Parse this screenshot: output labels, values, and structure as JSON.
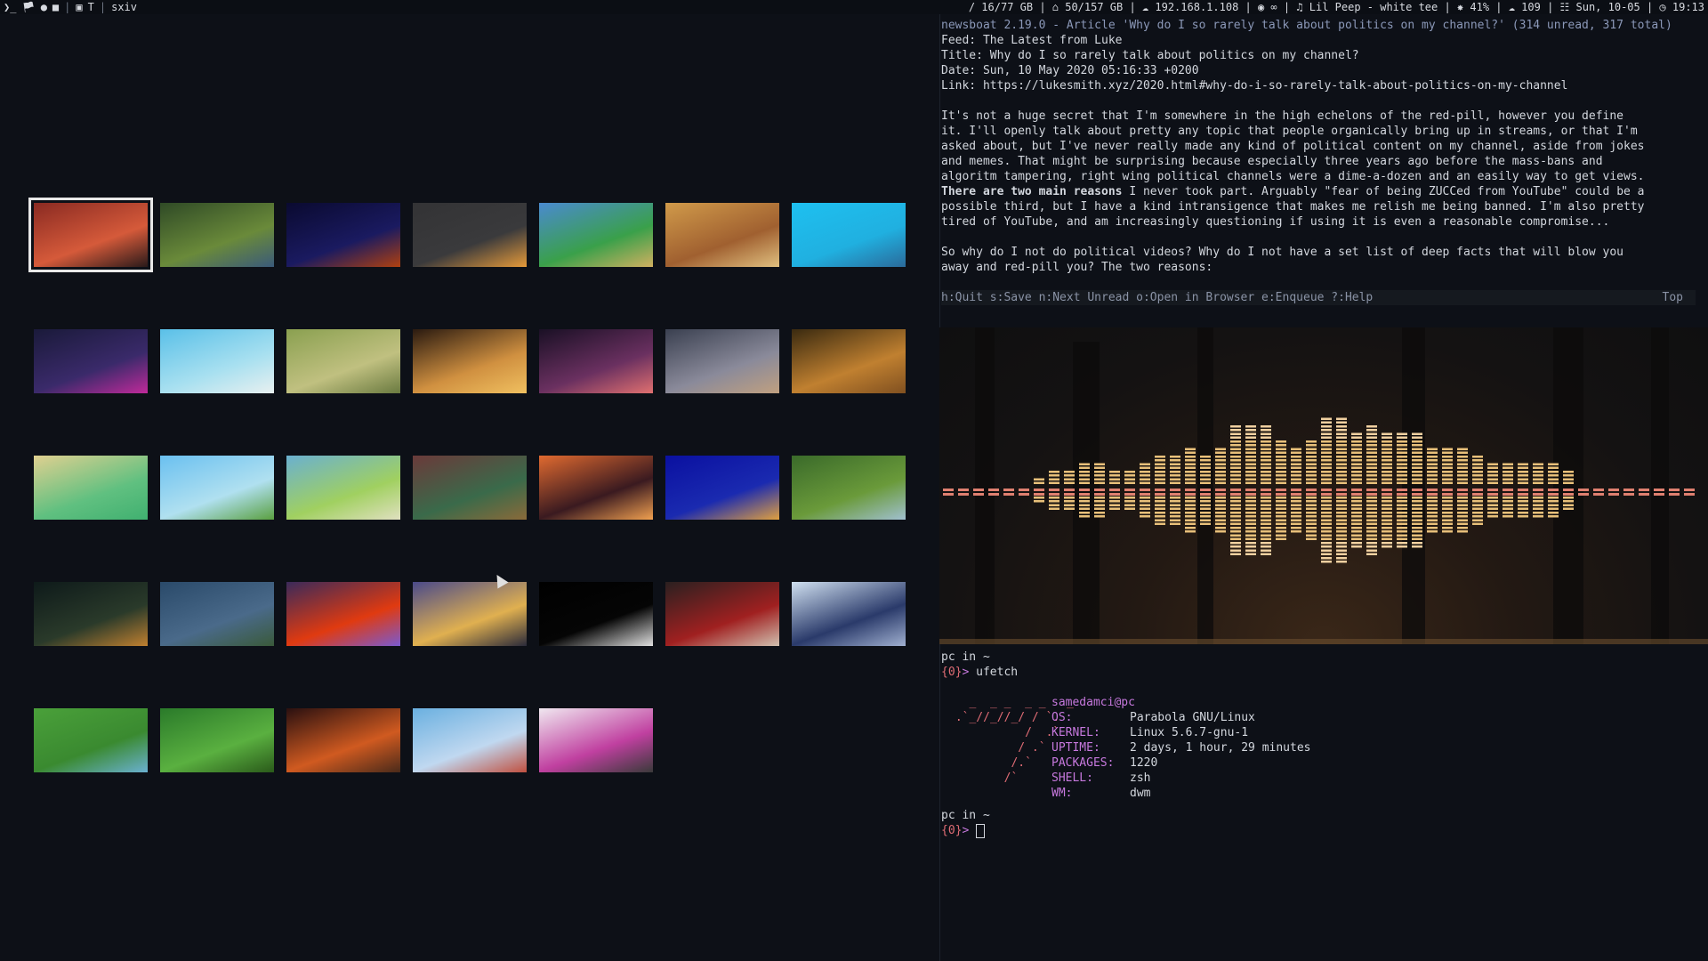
{
  "topbar": {
    "left_icons": [
      "terminal-icon",
      "tag-icon",
      "globe-icon",
      "chat-icon",
      "window-icon"
    ],
    "layout_symbol": "T",
    "window_title": "sxiv",
    "status": " / 16/77 GB | ⌂ 50/157 GB | ☁ 192.168.1.108 | ◉ ∞ | ♫ Lil Peep - white tee | ✸ 41% | ☁ 109 | ☷ Sun, 10-05 | ◷ 19:13"
  },
  "sxiv": {
    "thumbnails": [
      {
        "name": "thumb-anime-red",
        "colors": [
          "#8a2a22",
          "#d55a3a",
          "#2a1a1a"
        ],
        "selected": true
      },
      {
        "name": "thumb-river-valley",
        "colors": [
          "#2f4a26",
          "#6a8a3a",
          "#3a5a7a"
        ]
      },
      {
        "name": "thumb-pixel-night-fire",
        "colors": [
          "#0a0a30",
          "#1a1a60",
          "#b04010"
        ]
      },
      {
        "name": "thumb-sun-circle",
        "colors": [
          "#333335",
          "#3a3a3c",
          "#e59a3a"
        ]
      },
      {
        "name": "thumb-world-map",
        "colors": [
          "#4a8ad0",
          "#3aa04a",
          "#d0b060"
        ]
      },
      {
        "name": "thumb-castle-town",
        "colors": [
          "#d09a4a",
          "#a06030",
          "#e0c080"
        ]
      },
      {
        "name": "thumb-ocean-island",
        "colors": [
          "#1ec0f0",
          "#20b0e0",
          "#2a6a9a"
        ]
      },
      {
        "name": "thumb-cyber-room",
        "colors": [
          "#1a1a3a",
          "#3a2a6a",
          "#c02a9a"
        ]
      },
      {
        "name": "thumb-sky-tower",
        "colors": [
          "#5ac0e8",
          "#a8e0f0",
          "#e8f0f0"
        ]
      },
      {
        "name": "thumb-castle-hill",
        "colors": [
          "#8aa050",
          "#c0c080",
          "#6a7a40"
        ]
      },
      {
        "name": "thumb-golden-hall",
        "colors": [
          "#2a1a10",
          "#d09040",
          "#f0c060"
        ]
      },
      {
        "name": "thumb-purple-sunset",
        "colors": [
          "#1a1025",
          "#6a3060",
          "#e07070"
        ]
      },
      {
        "name": "thumb-futuristic-city",
        "colors": [
          "#3a4050",
          "#8a8a9a",
          "#c0a080"
        ]
      },
      {
        "name": "thumb-autumn-forest",
        "colors": [
          "#3a2a10",
          "#c08030",
          "#805020"
        ]
      },
      {
        "name": "thumb-pixel-village",
        "colors": [
          "#e0d090",
          "#60c080",
          "#40b070"
        ]
      },
      {
        "name": "thumb-sky-moving-castle",
        "colors": [
          "#6ac0f0",
          "#b0e0f0",
          "#5aa040"
        ]
      },
      {
        "name": "thumb-painted-landscape",
        "colors": [
          "#6ab0d0",
          "#a0d060",
          "#e0e0c0"
        ]
      },
      {
        "name": "thumb-collage",
        "colors": [
          "#6a3a3a",
          "#3a6a4a",
          "#8a6a3a"
        ]
      },
      {
        "name": "thumb-orange-sunset-girl",
        "colors": [
          "#e06a30",
          "#3a1a20",
          "#f0a050"
        ]
      },
      {
        "name": "thumb-balloon-blue",
        "colors": [
          "#0a10a0",
          "#1a2ab0",
          "#e0a040"
        ]
      },
      {
        "name": "thumb-green-hills",
        "colors": [
          "#3a6a2a",
          "#6a9a3a",
          "#a0c0d0"
        ]
      },
      {
        "name": "thumb-dark-forest-light",
        "colors": [
          "#0e1a1a",
          "#2a3a2a",
          "#c08030"
        ]
      },
      {
        "name": "thumb-mountain-waterfall",
        "colors": [
          "#2a4a6a",
          "#4a6a8a",
          "#3a5a3a"
        ]
      },
      {
        "name": "thumb-red-sun-sea",
        "colors": [
          "#3a2a5a",
          "#e03a10",
          "#7a5ad0"
        ]
      },
      {
        "name": "thumb-sunset-flowers",
        "colors": [
          "#4a4a8a",
          "#e0b050",
          "#2a2a3a"
        ]
      },
      {
        "name": "thumb-black-cat",
        "colors": [
          "#000000",
          "#050505",
          "#e0e0e0"
        ]
      },
      {
        "name": "thumb-anime-redcoat",
        "colors": [
          "#2a2020",
          "#a02020",
          "#d0c0b0"
        ]
      },
      {
        "name": "thumb-anime-gun",
        "colors": [
          "#d0e0f0",
          "#2a3a6a",
          "#a0b0d0"
        ]
      },
      {
        "name": "thumb-green-pixel",
        "colors": [
          "#4aa03a",
          "#3a8a30",
          "#6ab0d0"
        ]
      },
      {
        "name": "thumb-forest-canopy",
        "colors": [
          "#2a7a2a",
          "#5ab040",
          "#2a5a1a"
        ]
      },
      {
        "name": "thumb-city-lights",
        "colors": [
          "#2a1010",
          "#d05a20",
          "#4a2a1a"
        ]
      },
      {
        "name": "thumb-floating-island",
        "colors": [
          "#6ab0e0",
          "#c0d8f0",
          "#c05040"
        ]
      },
      {
        "name": "thumb-anime-checker",
        "colors": [
          "#f0e8f0",
          "#c040a0",
          "#3a3a3a"
        ]
      }
    ]
  },
  "newsboat": {
    "title_line": "newsboat 2.19.0 - Article 'Why do I so rarely talk about politics on my channel?' (314 unread, 317 total)",
    "feed": "Feed: The Latest from Luke",
    "title": "Title: Why do I so rarely talk about politics on my channel?",
    "date": "Date: Sun, 10 May 2020 05:16:33 +0200",
    "link": "Link: https://lukesmith.xyz/2020.html#why-do-i-so-rarely-talk-about-politics-on-my-channel",
    "para1": [
      "It's not a huge secret that I'm somewhere in the high echelons of the red-pill, however you define",
      "it. I'll openly talk about pretty any topic that people organically bring up in streams, or that I'm",
      "asked about, but I've never really made any kind of political content on my channel, aside from jokes",
      "and memes. That might be surprising because especially three years ago before the mass-bans and",
      "algoritm tampering, right wing political channels were a dime-a-dozen and an easily way to get views."
    ],
    "para1_bold": "There are two main reasons",
    "para1_rest": [
      " I never took part. Arguably \"fear of being ZUCCed from YouTube\" could be a",
      "possible third, but I have a kind intransigence that makes me relish me being banned. I'm also pretty",
      "tired of YouTube, and am increasingly questioning if using it is even a reasonable compromise..."
    ],
    "para2": [
      "So why do I not do political videos? Why do I not have a set list of deep facts that will blow you",
      "away and red-pill you? The two reasons:"
    ],
    "help_line": "h:Quit s:Save n:Next Unread o:Open in Browser e:Enqueue ?:Help",
    "position": "Top"
  },
  "visualizer": {
    "levels": [
      0,
      0,
      0,
      0,
      0,
      0,
      1,
      2,
      2,
      3,
      3,
      2,
      2,
      3,
      4,
      4,
      5,
      4,
      5,
      8,
      8,
      8,
      6,
      5,
      6,
      9,
      9,
      7,
      8,
      7,
      7,
      7,
      5,
      5,
      5,
      4,
      3,
      3,
      3,
      3,
      3,
      2,
      0,
      0,
      0,
      0,
      0,
      0,
      0,
      0
    ]
  },
  "terminal": {
    "prompt1_user": "pc",
    "prompt1_in": " in ",
    "prompt1_dir": "~",
    "prompt1_num": "{0}",
    "prompt1_arrow": ">",
    "command": " ufetch",
    "userhost": "samedamci@pc",
    "logo_lines": [
      "   _  _ _  _ _   _",
      " .`_//_//_/ / `.",
      "           /  .`",
      "          / .`",
      "         /.`",
      "        /`"
    ],
    "info": [
      {
        "key": "OS:",
        "value": "Parabola GNU/Linux"
      },
      {
        "key": "KERNEL:",
        "value": "Linux 5.6.7-gnu-1"
      },
      {
        "key": "UPTIME:",
        "value": "2 days, 1 hour, 29 minutes"
      },
      {
        "key": "PACKAGES:",
        "value": "1220"
      },
      {
        "key": "SHELL:",
        "value": "zsh"
      },
      {
        "key": "WM:",
        "value": "dwm"
      }
    ],
    "prompt2_user": "pc",
    "prompt2_in": " in ",
    "prompt2_dir": "~",
    "prompt2_num": "{0}",
    "prompt2_arrow": ">"
  },
  "colors": {
    "accent": "#c678dd",
    "error": "#e06c75",
    "bar_low": "#e8c07a",
    "bar_high": "#f0d0a0",
    "bar_mid": "#e08070"
  }
}
